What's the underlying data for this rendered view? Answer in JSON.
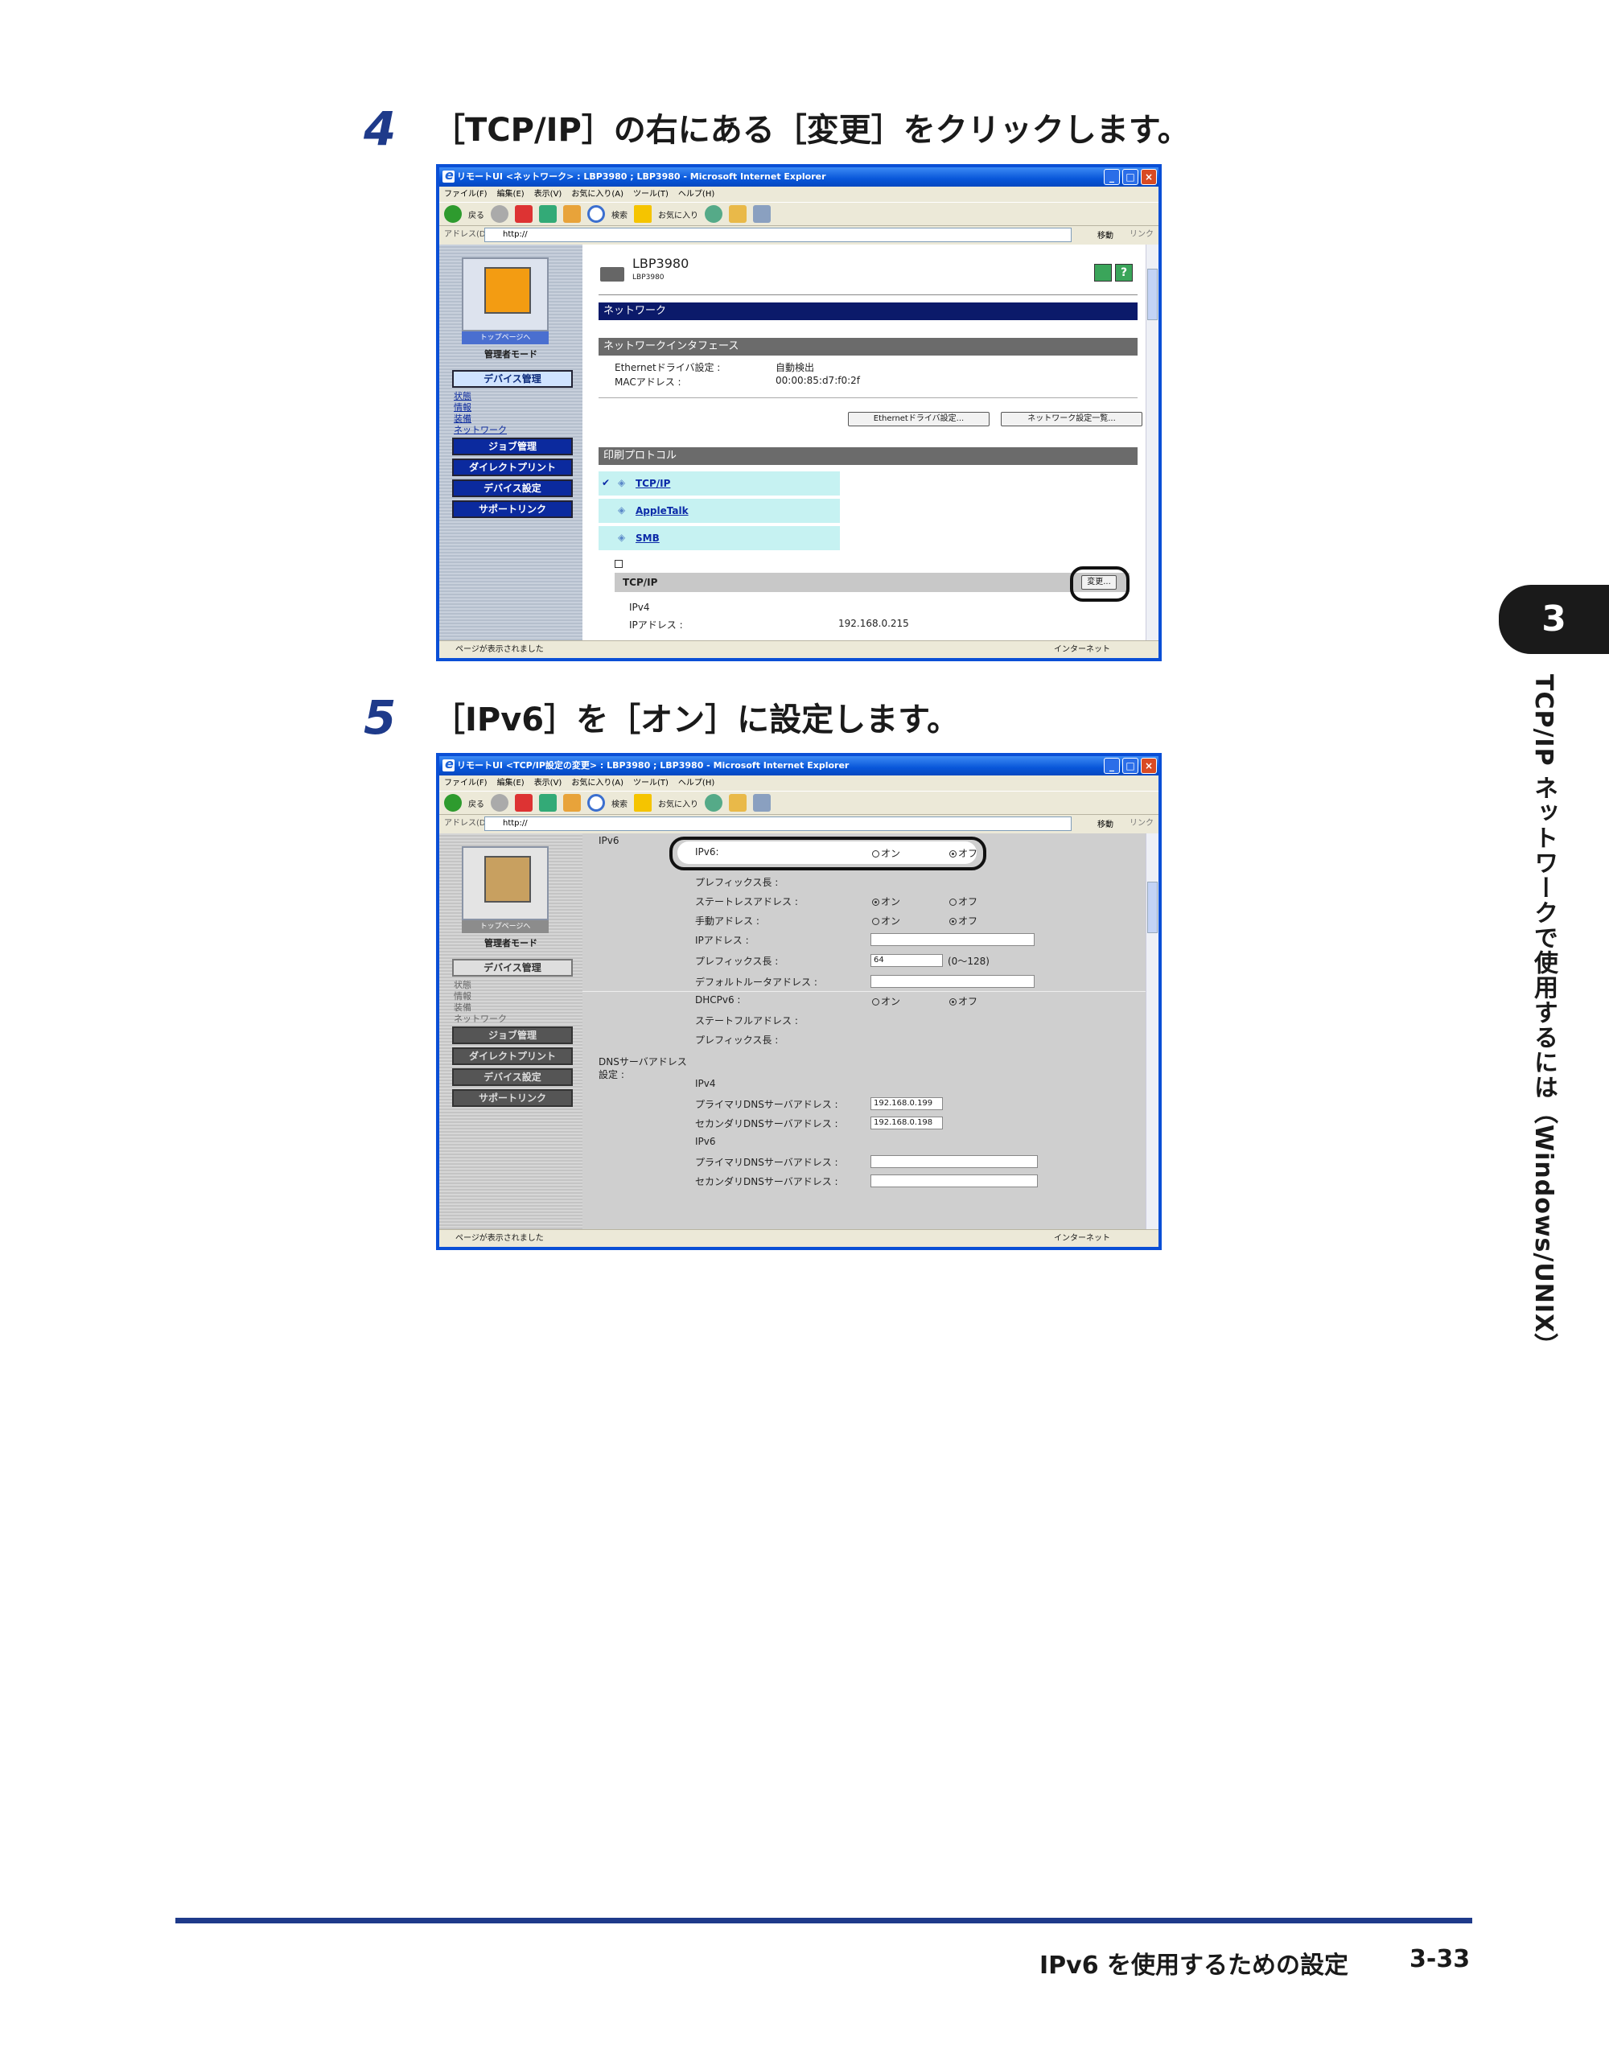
{
  "steps": [
    {
      "num": "4",
      "text": "［TCP/IP］の右にある［変更］をクリックします。"
    },
    {
      "num": "5",
      "text": "［IPv6］を［オン］に設定します。"
    }
  ],
  "shot1": {
    "title": "リモートUI <ネットワーク> : LBP3980 ; LBP3980 - Microsoft Internet Explorer",
    "menu": [
      "ファイル(F)",
      "編集(E)",
      "表示(V)",
      "お気に入り(A)",
      "ツール(T)",
      "ヘルプ(H)"
    ],
    "toolbar": {
      "back": "戻る",
      "search": "検索",
      "favorites": "お気に入り"
    },
    "address_label": "アドレス(D)",
    "address": "http://",
    "go": "移動",
    "links": "リンク",
    "status": "ページが表示されました",
    "zone": "インターネット",
    "left": {
      "top_page": "トップページへ",
      "mode": "管理者モード",
      "device_mgmt": "デバイス管理",
      "subs": [
        "状態",
        "情報",
        "装備",
        "ネットワーク"
      ],
      "job": "ジョブ管理",
      "direct": "ダイレクトプリント",
      "device_settings": "デバイス設定",
      "support": "サポートリンク"
    },
    "device_name": "LBP3980",
    "device_sub": "LBP3980",
    "section": "ネットワーク",
    "iface": "ネットワークインタフェース",
    "eth_label": "Ethernetドライバ設定 :",
    "eth_value": "自動検出",
    "mac_label": "MACアドレス :",
    "mac_value": "00:00:85:d7:f0:2f",
    "btn_eth": "Ethernetドライバ設定...",
    "btn_net": "ネットワーク設定一覧...",
    "protocols_title": "印刷プロトコル",
    "protocols": [
      "TCP/IP",
      "AppleTalk",
      "SMB"
    ],
    "tcp_header": "TCP/IP",
    "change_btn": "変更...",
    "ipv4": "IPv4",
    "ip_label": "IPアドレス :",
    "ip_value": "192.168.0.215"
  },
  "shot2": {
    "title": "リモートUI <TCP/IP設定の変更> : LBP3980 ; LBP3980 - Microsoft Internet Explorer",
    "ipv6_section": "IPv6",
    "ipv6_label": "IPv6:",
    "on": "オン",
    "off": "オフ",
    "prefix_len": "プレフィックス長 :",
    "stateless": "ステートレスアドレス :",
    "manual": "手動アドレス :",
    "ip_addr": "IPアドレス :",
    "prefix_len2": "プレフィックス長 :",
    "prefix_value": "64",
    "prefix_range": "(0〜128)",
    "default_router": "デフォルトルータアドレス :",
    "dhcp": "DHCPv6 :",
    "stateful": "ステートフルアドレス :",
    "prefix_len3": "プレフィックス長 :",
    "dns_label": "DNSサーバアドレス設定 :",
    "ipv4": "IPv4",
    "primary_dns": "プライマリDNSサーバアドレス :",
    "primary_value": "192.168.0.199",
    "secondary_dns": "セカンダリDNSサーバアドレス :",
    "secondary_value": "192.168.0.198",
    "ipv6": "IPv6",
    "primary_dns6": "プライマリDNSサーバアドレス :",
    "secondary_dns6": "セカンダリDNSサーバアドレス :"
  },
  "side": {
    "chapter": "3",
    "title": "TCP/IP ネットワークで使用するには（Windows/UNIX）"
  },
  "footer": {
    "section": "IPv6 を使用するための設定",
    "page": "3-33"
  }
}
